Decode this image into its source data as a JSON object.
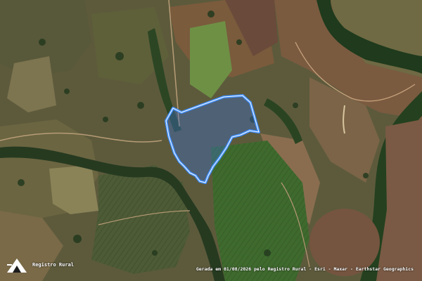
{
  "map": {
    "style": "satellite imagery",
    "boundary_color": "#3f8fff",
    "boundary_fill": "#3a6fd0"
  },
  "branding": {
    "logo_icon": "registro-rural-logo",
    "name": "Registro Rural"
  },
  "attribution": "Gerada em 01/08/2026 pelo Registro Rural - Esri - Maxar - Earthstar Geographics"
}
